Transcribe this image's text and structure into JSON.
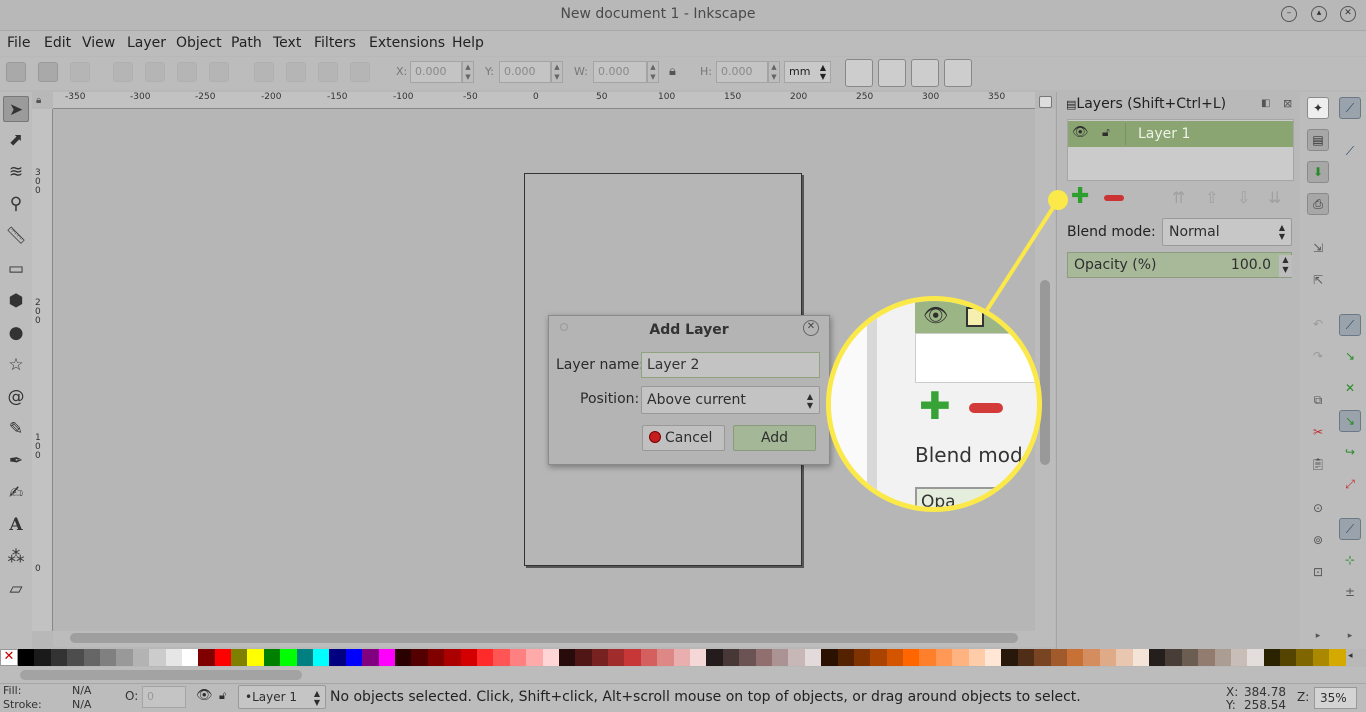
{
  "window": {
    "title": "New document 1 - Inkscape",
    "controls": [
      "minimize",
      "maximize",
      "close"
    ]
  },
  "menu": [
    "File",
    "Edit",
    "View",
    "Layer",
    "Object",
    "Path",
    "Text",
    "Filters",
    "Extensions",
    "Help"
  ],
  "toolbar": {
    "x_label": "X:",
    "x_value": "0.000",
    "y_label": "Y:",
    "y_value": "0.000",
    "w_label": "W:",
    "w_value": "0.000",
    "h_label": "H:",
    "h_value": "0.000",
    "unit": "mm"
  },
  "ruler": {
    "h_ticks": [
      "-350",
      "-300",
      "-250",
      "-200",
      "-150",
      "-100",
      "-50",
      "0",
      "50",
      "100",
      "150",
      "200",
      "250",
      "300",
      "350"
    ],
    "v_ticks": [
      "300",
      "200",
      "100",
      "0"
    ]
  },
  "layers_panel": {
    "title": "Layers (Shift+Ctrl+L)",
    "layers": [
      {
        "name": "Layer 1"
      }
    ],
    "blend_label": "Blend mode:",
    "blend_value": "Normal",
    "opacity_label": "Opacity (%)",
    "opacity_value": "100.0"
  },
  "dialog": {
    "title": "Add Layer",
    "name_label": "Layer name:",
    "name_value": "Layer 2",
    "position_label": "Position:",
    "position_value": "Above current",
    "cancel_label": "Cancel",
    "add_label": "Add"
  },
  "magnifier": {
    "text": "Blend mode",
    "opacity_fragment": "Opa"
  },
  "status": {
    "fill_label": "Fill:",
    "fill_value": "N/A",
    "stroke_label": "Stroke:",
    "stroke_value": "N/A",
    "opacity_label": "O:",
    "opacity_value": "0",
    "layer": "•Layer 1",
    "message": "No objects selected. Click, Shift+click, Alt+scroll mouse on top of objects, or drag around objects to select.",
    "x_label": "X:",
    "x_value": "384.78",
    "y_label": "Y:",
    "y_value": "258.54",
    "zoom_label": "Z:",
    "zoom_value": "35%"
  },
  "palette_colors": [
    "#000000",
    "#1a1a1a",
    "#333333",
    "#4d4d4d",
    "#666666",
    "#808080",
    "#999999",
    "#b3b3b3",
    "#cccccc",
    "#e6e6e6",
    "#ffffff",
    "#800000",
    "#ff0000",
    "#808000",
    "#ffff00",
    "#008000",
    "#00ff00",
    "#008080",
    "#00ffff",
    "#000080",
    "#0000ff",
    "#800080",
    "#ff00ff",
    "#2b0000",
    "#550000",
    "#800000",
    "#aa0000",
    "#d40000",
    "#ff2a2a",
    "#ff5555",
    "#ff8080",
    "#ffaaaa",
    "#ffd5d5",
    "#280b0b",
    "#501616",
    "#782121",
    "#a02c2c",
    "#c83737",
    "#d35f5f",
    "#de8787",
    "#e9afaf",
    "#f4d7d7",
    "#241c1c",
    "#483737",
    "#6c5353",
    "#916f6f",
    "#ac9393",
    "#c8b7b7",
    "#e3dbdb",
    "#2b1100",
    "#552200",
    "#803300",
    "#aa4400",
    "#d45500",
    "#ff6600",
    "#ff7f2a",
    "#ff9955",
    "#ffb380",
    "#ffccaa",
    "#ffe6d5",
    "#28170b",
    "#502d16",
    "#784421",
    "#a05a2c",
    "#c87137",
    "#d38d5f",
    "#deaa87",
    "#e9c6af",
    "#f4e3d7",
    "#241f1c",
    "#483e37",
    "#6c5d53",
    "#917c6f",
    "#ac9d93",
    "#c8beb7",
    "#e3dedb",
    "#2b2200",
    "#554400",
    "#806600",
    "#aa8800",
    "#d4aa00"
  ],
  "accent": {
    "layer_selected": "#8aa472",
    "callout": "#fbe94a"
  }
}
